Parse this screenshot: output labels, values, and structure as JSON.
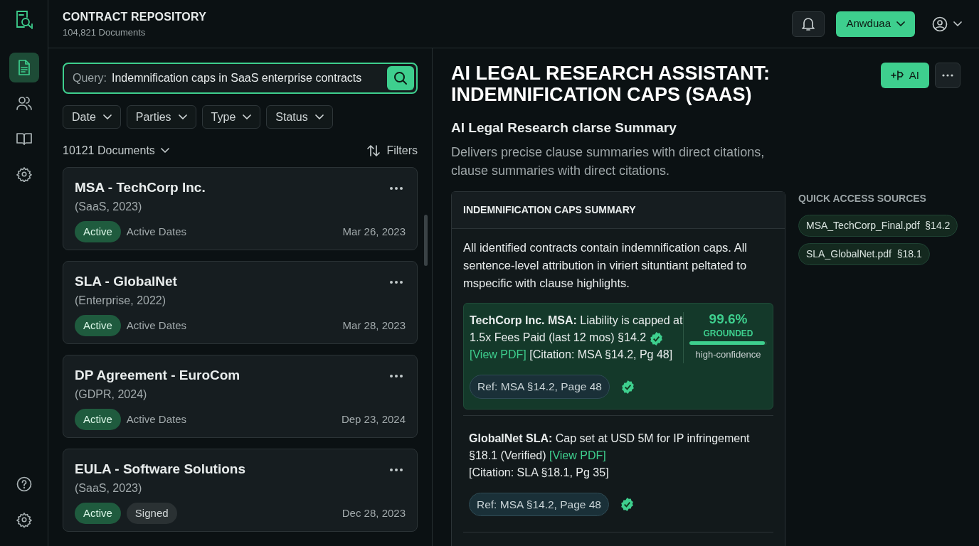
{
  "sidebar": {
    "top_items": [
      {
        "kind": "document",
        "selected": true
      },
      {
        "kind": "people",
        "selected": false
      },
      {
        "kind": "book",
        "selected": false
      },
      {
        "kind": "gear",
        "selected": false
      }
    ],
    "bottom_items": [
      {
        "kind": "help",
        "selected": false
      },
      {
        "kind": "gear",
        "selected": false
      }
    ]
  },
  "header": {
    "title": "CONTRACT REPOSITORY",
    "subtitle": "104,821 Documents",
    "workspace_button": "Anwduaa"
  },
  "search": {
    "prefix": "Query:",
    "value": "Indemnification caps in SaaS enterprise contracts"
  },
  "filters": [
    "Date",
    "Parties",
    "Type",
    "Status"
  ],
  "results": {
    "count": "10121 Documents",
    "filters_button": "Filters"
  },
  "documents": [
    {
      "title": "MSA - TechCorp Inc.",
      "subtitle": "(SaaS, 2023)",
      "tags": [
        {
          "label": "Active",
          "kind": "status"
        }
      ],
      "meta": "Active Dates",
      "date": "Mar 26, 2023"
    },
    {
      "title": "SLA - GlobalNet",
      "subtitle": "(Enterprise, 2022)",
      "tags": [
        {
          "label": "Active",
          "kind": "status"
        }
      ],
      "meta": "Active Dates",
      "date": "Mar 28, 2023"
    },
    {
      "title": "DP Agreement - EuroCom",
      "subtitle": "(GDPR, 2024)",
      "tags": [
        {
          "label": "Active",
          "kind": "status"
        }
      ],
      "meta": "Active Dates",
      "date": "Dep 23, 2024"
    },
    {
      "title": "EULA - Software Solutions",
      "subtitle": "(SaaS, 2023)",
      "tags": [
        {
          "label": "Active",
          "kind": "status"
        },
        {
          "label": "Signed",
          "kind": "tag"
        }
      ],
      "date": "Dec 28, 2023"
    }
  ],
  "assistant": {
    "title": "AI LEGAL RESEARCH ASSISTANT: INDEMNIFICATION CAPS (SAAS)",
    "ai_button": "AI",
    "subtitle": "AI Legal Research clarse Summary",
    "description": "Delivers precise clause summaries with direct citations, clause summaries with direct citations.",
    "summary": {
      "heading": "INDEMNIFICATION CAPS SUMMARY",
      "intro": "All identified contracts contain indemnification caps. All sentence-level attribution in viriert situntiant peltated to mspecific with clause highlights.",
      "findings": [
        {
          "highlighted": true,
          "lead": "TechCorp Inc. MSA:",
          "text": "Liability is capped at 1.5x Fees Paid (last 12 mos) §14.2",
          "verified": true,
          "link": "[View PDF]",
          "citation": "[Citation: MSA §14.2, Pg 48]",
          "citation_newline": false,
          "score": {
            "value": "99.6%",
            "label": "GROUNDED",
            "level": 0.97,
            "confidence": "high-confidence"
          },
          "ref": "Ref: MSA §14.2, Page 48",
          "ref_verified": true
        },
        {
          "highlighted": false,
          "lead": "GlobalNet SLA:",
          "text": "Cap set at USD 5M for IP infringement §18.1 (Verified)",
          "verified": false,
          "link": "[View PDF]",
          "citation": "[Citation: SLA §18.1, Pg 35]",
          "citation_newline": true,
          "ref": "Ref: MSA §14.2, Page 48",
          "ref_verified": true
        }
      ]
    },
    "sources": {
      "heading": "QUICK ACCESS SOURCES",
      "items": [
        "MSA_TechCorp_Final.pdf  §14.2",
        "SLA_GlobalNet.pdf  §18.1"
      ]
    }
  }
}
